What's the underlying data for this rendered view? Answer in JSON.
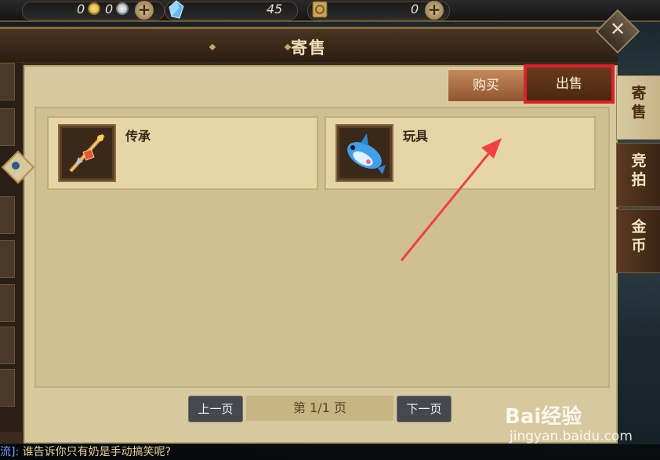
{
  "topbar": {
    "gold_value": "0",
    "silver_value": "0",
    "crystal_value": "45",
    "scroll_value": "0"
  },
  "window": {
    "title": "寄售",
    "buttons": {
      "buy": "购买",
      "sell": "出售"
    },
    "items": [
      {
        "label": "传承",
        "icon": "weapon-icon"
      },
      {
        "label": "玩具",
        "icon": "shark-toy-icon"
      }
    ],
    "pager": {
      "prev": "上一页",
      "info": "第 1/1 页",
      "next": "下一页"
    }
  },
  "right_tabs": [
    {
      "label": "寄售",
      "active": true
    },
    {
      "label": "竞拍",
      "active": false
    },
    {
      "label": "金币",
      "active": false
    }
  ],
  "chat": {
    "channel": "流]:",
    "message": "谁告诉你只有奶是手动搞笑呢?"
  },
  "watermark": {
    "brand": "Bai经验",
    "url": "jingyan.baidu.com"
  },
  "colors": {
    "highlight": "#e01f2c",
    "arrow": "#f04040"
  }
}
